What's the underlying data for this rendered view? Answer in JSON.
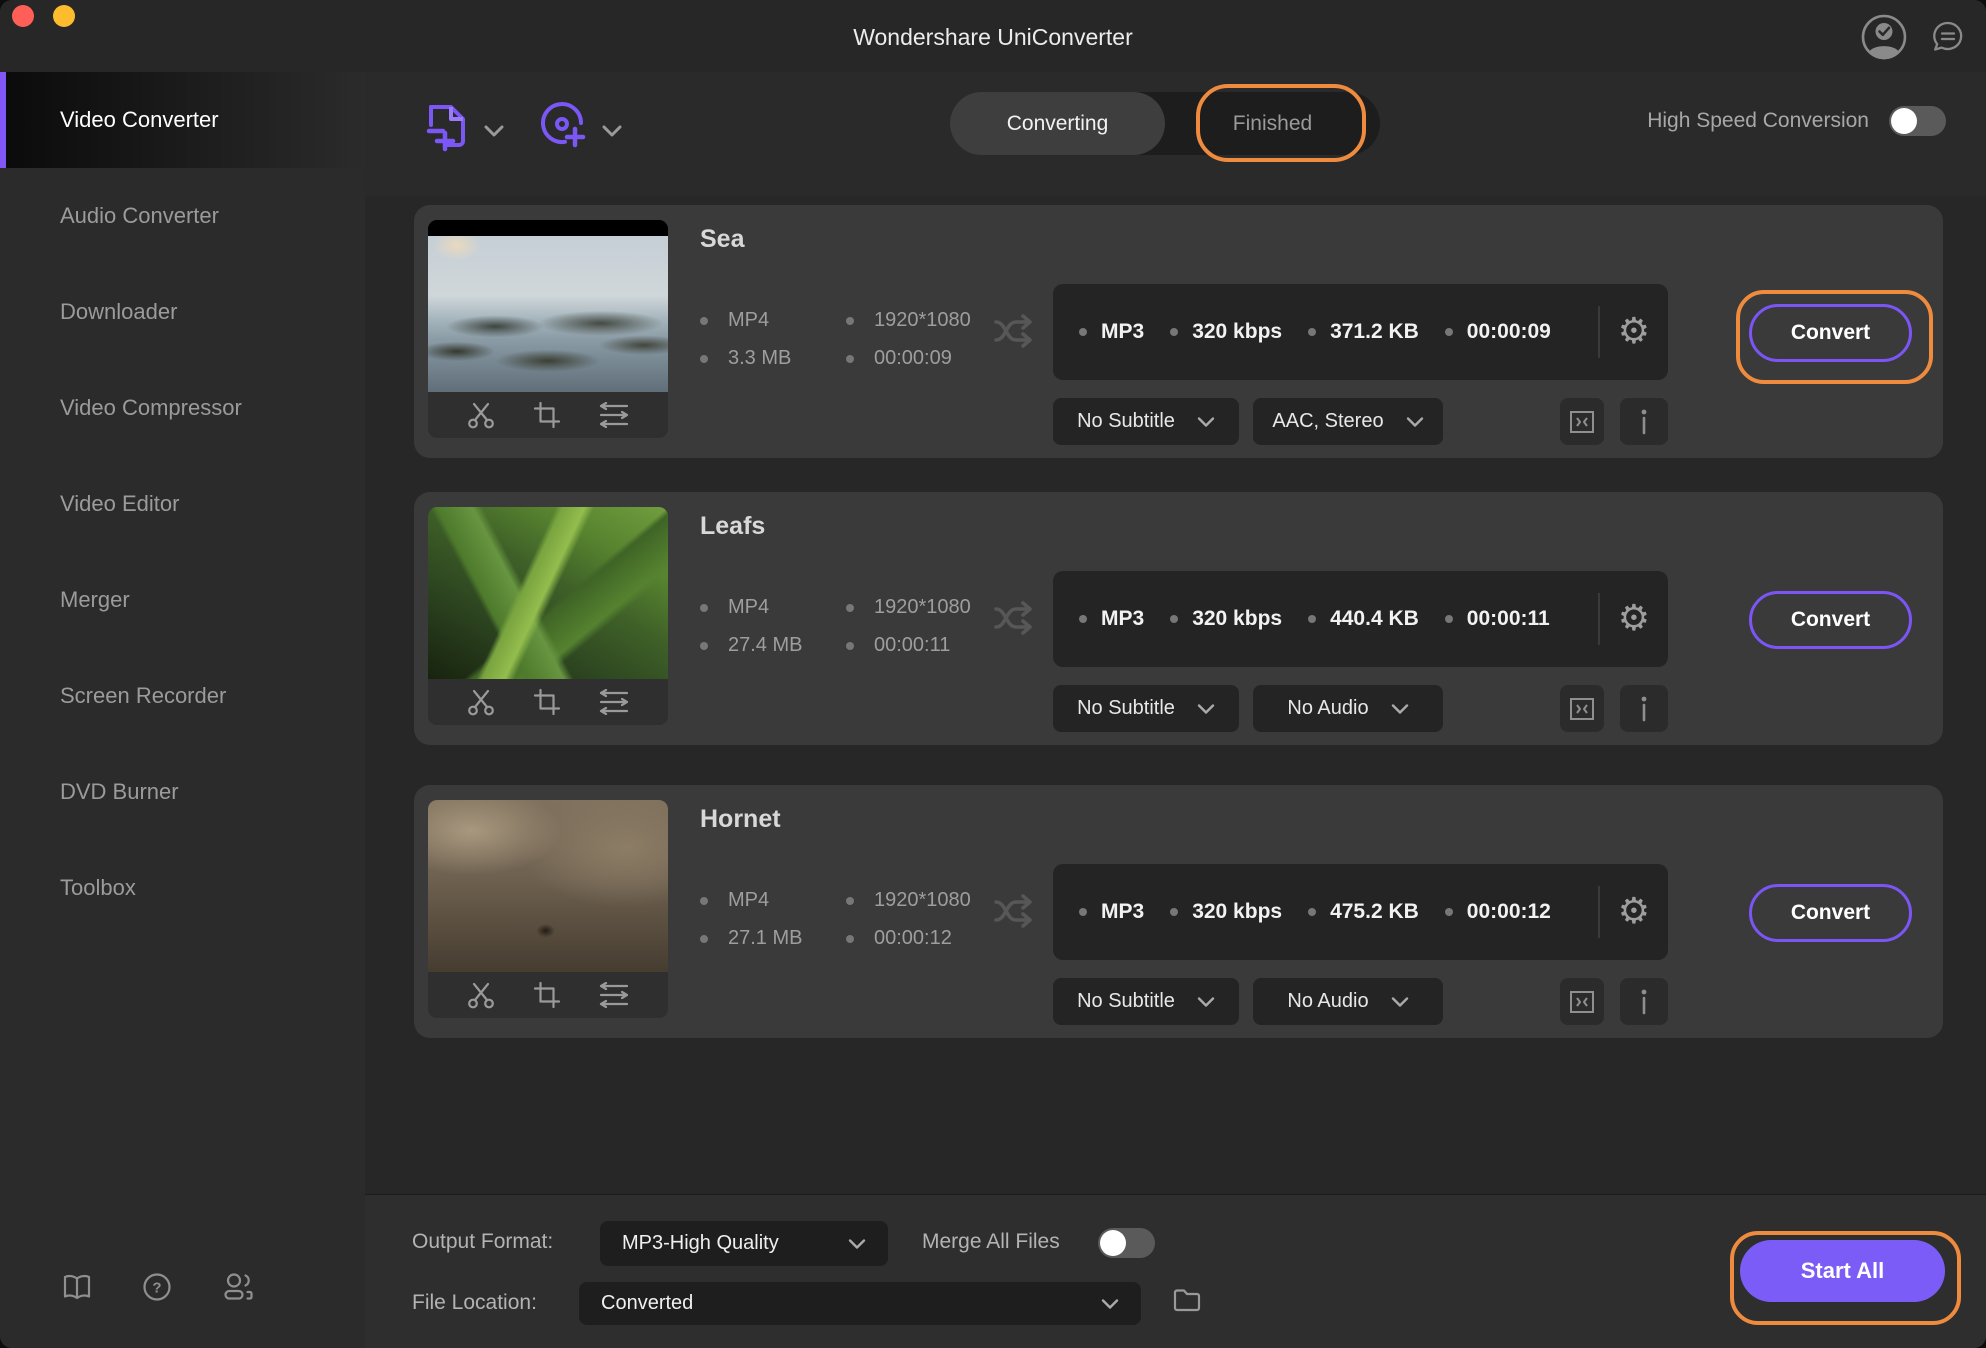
{
  "window": {
    "title": "Wondershare UniConverter"
  },
  "sidebar": {
    "items": [
      {
        "label": "Video Converter",
        "active": true
      },
      {
        "label": "Audio Converter",
        "active": false
      },
      {
        "label": "Downloader",
        "active": false
      },
      {
        "label": "Video Compressor",
        "active": false
      },
      {
        "label": "Video Editor",
        "active": false
      },
      {
        "label": "Merger",
        "active": false
      },
      {
        "label": "Screen Recorder",
        "active": false
      },
      {
        "label": "DVD Burner",
        "active": false
      },
      {
        "label": "Toolbox",
        "active": false
      }
    ]
  },
  "toolbar": {
    "tab_converting": "Converting",
    "tab_finished": "Finished",
    "active_tab": "Converting",
    "high_speed_label": "High Speed Conversion",
    "high_speed_on": false
  },
  "rows": [
    {
      "title": "Sea",
      "format": "MP4",
      "resolution": "1920*1080",
      "size": "3.3 MB",
      "duration": "00:00:09",
      "out_format": "MP3",
      "out_bitrate": "320 kbps",
      "out_size": "371.2 KB",
      "out_duration": "00:00:09",
      "subtitle": "No Subtitle",
      "audio": "AAC, Stereo",
      "convert_label": "Convert",
      "highlighted": true
    },
    {
      "title": "Leafs",
      "format": "MP4",
      "resolution": "1920*1080",
      "size": "27.4 MB",
      "duration": "00:00:11",
      "out_format": "MP3",
      "out_bitrate": "320 kbps",
      "out_size": "440.4 KB",
      "out_duration": "00:00:11",
      "subtitle": "No Subtitle",
      "audio": "No Audio",
      "convert_label": "Convert",
      "highlighted": false
    },
    {
      "title": "Hornet",
      "format": "MP4",
      "resolution": "1920*1080",
      "size": "27.1 MB",
      "duration": "00:00:12",
      "out_format": "MP3",
      "out_bitrate": "320 kbps",
      "out_size": "475.2 KB",
      "out_duration": "00:00:12",
      "subtitle": "No Subtitle",
      "audio": "No Audio",
      "convert_label": "Convert",
      "highlighted": false
    }
  ],
  "footer": {
    "output_format_label": "Output Format:",
    "output_format_value": "MP3-High Quality",
    "merge_label": "Merge All Files",
    "merge_on": false,
    "file_location_label": "File Location:",
    "file_location_value": "Converted",
    "start_all_label": "Start All"
  },
  "colors": {
    "accent_purple": "#7c5cf7",
    "annotation_orange": "#ee8b3e",
    "card_bg": "#3a3a3a",
    "panel_bg": "#242424"
  }
}
